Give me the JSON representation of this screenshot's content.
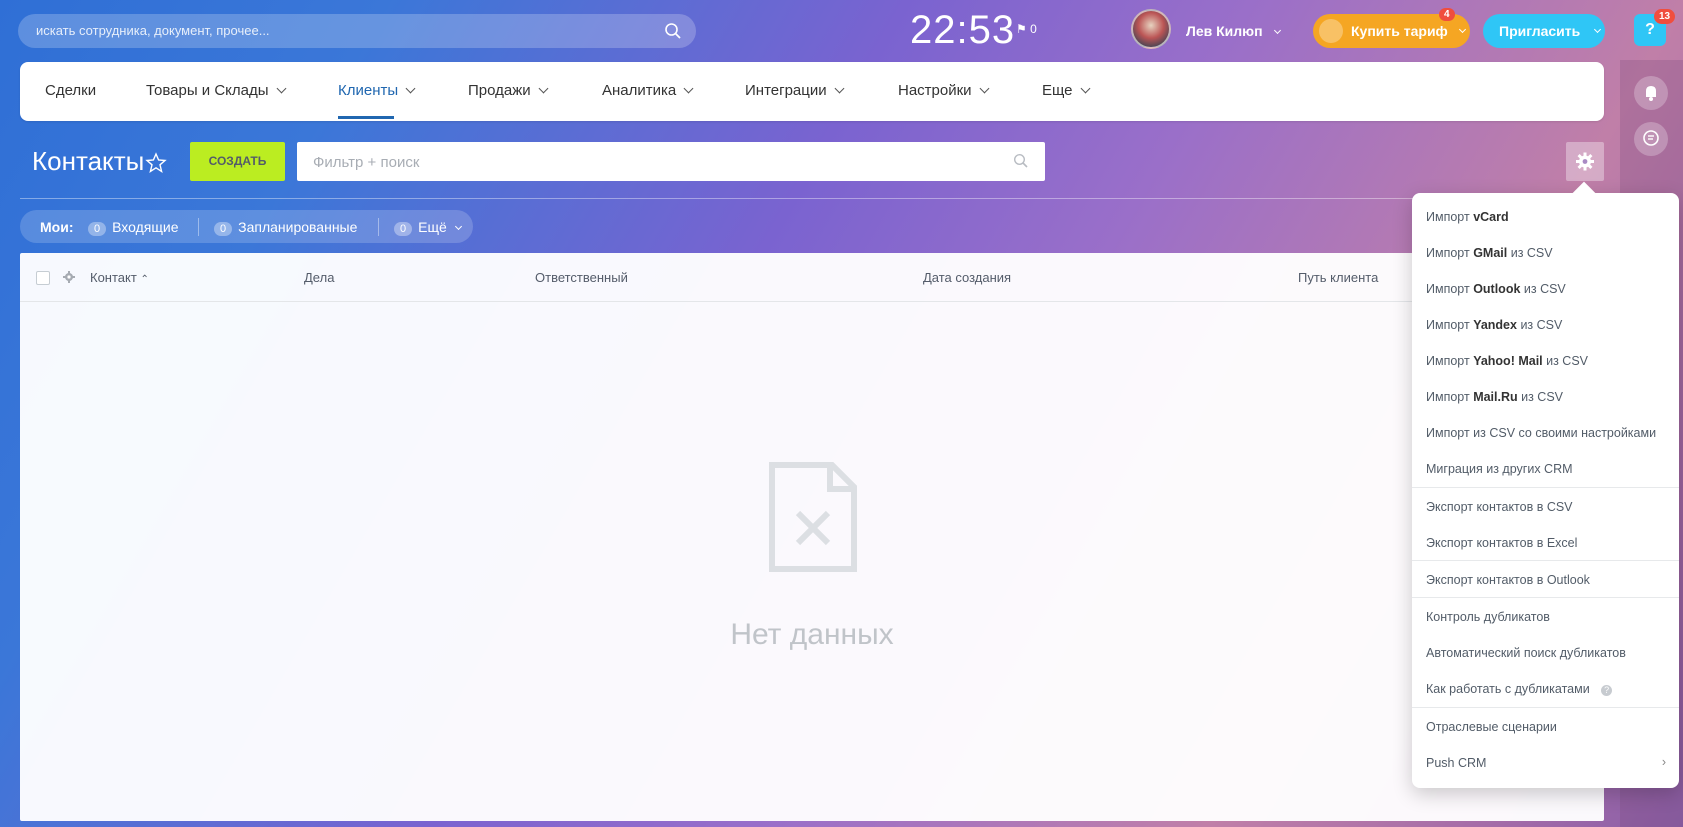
{
  "header": {
    "search_placeholder": "искать сотрудника, документ, прочее...",
    "clock": "22:53",
    "flag_count": "0",
    "user_name": "Лев Килюп",
    "buy_label": "Купить тариф",
    "buy_badge": "4",
    "invite_label": "Пригласить",
    "help_badge": "13"
  },
  "nav": {
    "items": [
      {
        "label": "Сделки"
      },
      {
        "label": "Товары и Склады"
      },
      {
        "label": "Клиенты"
      },
      {
        "label": "Продажи"
      },
      {
        "label": "Аналитика"
      },
      {
        "label": "Интеграции"
      },
      {
        "label": "Настройки"
      },
      {
        "label": "Еще"
      }
    ],
    "active": "Клиенты"
  },
  "toolbar": {
    "title": "Контакты",
    "create_label": "СОЗДАТЬ",
    "filter_placeholder": "Фильтр + поиск"
  },
  "counters": {
    "label": "Мои:",
    "items": [
      {
        "count": "0",
        "label": "Входящие"
      },
      {
        "count": "0",
        "label": "Запланированные"
      },
      {
        "count": "0",
        "label": "Ещё"
      }
    ]
  },
  "grid": {
    "columns": [
      "Контакт",
      "Дела",
      "Ответственный",
      "Дата создания",
      "Путь клиента"
    ],
    "empty_text": "Нет данных"
  },
  "menu": {
    "items": [
      {
        "pre": "Импорт ",
        "bold": "vCard",
        "post": ""
      },
      {
        "pre": "Импорт ",
        "bold": "GMail",
        "post": " из CSV"
      },
      {
        "pre": "Импорт ",
        "bold": "Outlook",
        "post": " из CSV"
      },
      {
        "pre": "Импорт ",
        "bold": "Yandex",
        "post": " из CSV"
      },
      {
        "pre": "Импорт ",
        "bold": "Yahoo! Mail",
        "post": " из CSV"
      },
      {
        "pre": "Импорт ",
        "bold": "Mail.Ru",
        "post": " из CSV"
      },
      {
        "pre": "Импорт из CSV со своими настройками",
        "bold": "",
        "post": ""
      },
      {
        "pre": "Миграция из других CRM",
        "bold": "",
        "post": ""
      },
      {
        "pre": "Экспорт контактов в CSV",
        "bold": "",
        "post": ""
      },
      {
        "pre": "Экспорт контактов в Excel",
        "bold": "",
        "post": ""
      },
      {
        "pre": "Экспорт контактов в Outlook",
        "bold": "",
        "post": ""
      },
      {
        "pre": "Контроль дубликатов",
        "bold": "",
        "post": ""
      },
      {
        "pre": "Автоматический поиск дубликатов",
        "bold": "",
        "post": ""
      },
      {
        "pre": "Как работать с дубликатами",
        "bold": "",
        "post": ""
      },
      {
        "pre": "Отраслевые сценарии",
        "bold": "",
        "post": ""
      },
      {
        "pre": "Push CRM",
        "bold": "",
        "post": ""
      }
    ]
  },
  "colors": {
    "accent": "#2067b0",
    "create": "#bbed21",
    "buy": "#f5a623",
    "invite": "#2fc6f6",
    "badge": "#f04e3e"
  }
}
